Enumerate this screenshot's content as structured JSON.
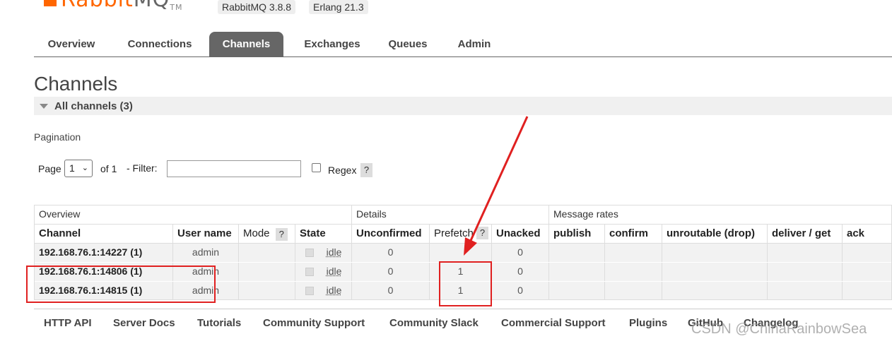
{
  "header": {
    "logo_brand": "Rabbit",
    "logo_suffix": "MQ",
    "logo_tm": "TM",
    "rabbitmq_version": "RabbitMQ 3.8.8",
    "erlang_version": "Erlang 21.3"
  },
  "nav": {
    "tabs": [
      "Overview",
      "Connections",
      "Channels",
      "Exchanges",
      "Queues",
      "Admin"
    ],
    "active": "Channels"
  },
  "page": {
    "title": "Channels",
    "section": "All channels (3)",
    "pagination_label": "Pagination"
  },
  "pagination": {
    "page_label": "Page",
    "page_value": "1",
    "of_label": "of 1",
    "filter_label": "- Filter:",
    "filter_value": "",
    "regex_label": "Regex",
    "help": "?"
  },
  "table": {
    "groups": [
      "Overview",
      "Details",
      "Message rates"
    ],
    "columns": [
      "Channel",
      "User name",
      "Mode",
      "State",
      "Unconfirmed",
      "Prefetch",
      "Unacked",
      "publish",
      "confirm",
      "unroutable (drop)",
      "deliver / get",
      "ack"
    ],
    "help": "?",
    "rows": [
      {
        "channel": "192.168.76.1:14227 (1)",
        "user": "admin",
        "mode": "",
        "state": "idle",
        "unconfirmed": "0",
        "prefetch": "",
        "unacked": "0"
      },
      {
        "channel": "192.168.76.1:14806 (1)",
        "user": "admin",
        "mode": "",
        "state": "idle",
        "unconfirmed": "0",
        "prefetch": "1",
        "unacked": "0"
      },
      {
        "channel": "192.168.76.1:14815 (1)",
        "user": "admin",
        "mode": "",
        "state": "idle",
        "unconfirmed": "0",
        "prefetch": "1",
        "unacked": "0"
      }
    ]
  },
  "footer": {
    "links": [
      "HTTP API",
      "Server Docs",
      "Tutorials",
      "Community Support",
      "Community Slack",
      "Commercial Support",
      "Plugins",
      "GitHub",
      "Changelog"
    ]
  },
  "watermark": "CSDN @ChinaRainbowSea",
  "colors": {
    "brand": "#ff6600",
    "active_tab": "#666666",
    "annotation": "#e02020"
  }
}
